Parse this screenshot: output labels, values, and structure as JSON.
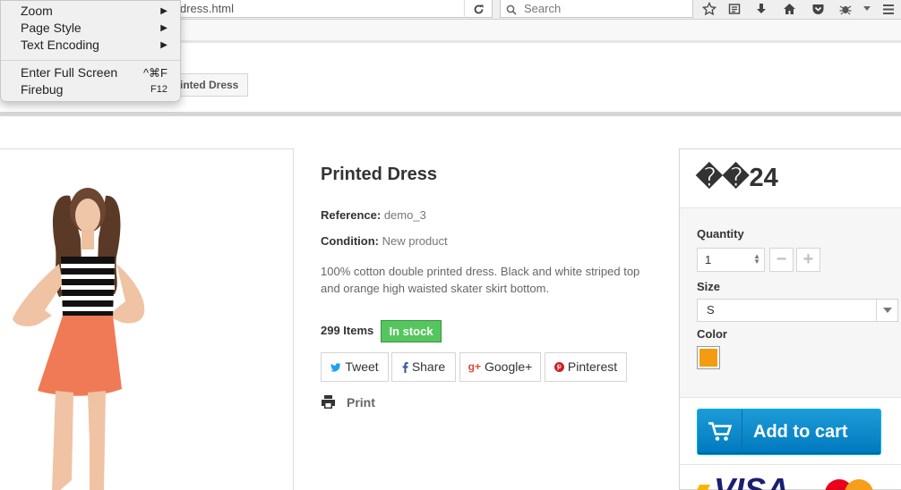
{
  "browser": {
    "url_fragment": "dress.html",
    "search_placeholder": "Search"
  },
  "context_menu": {
    "items": [
      {
        "label": "Zoom"
      },
      {
        "label": "Page Style"
      },
      {
        "label": "Text Encoding"
      },
      {
        "label": "Enter Full Screen",
        "shortcut": "^⌘F"
      },
      {
        "label": "Firebug",
        "shortcut": "F12"
      }
    ]
  },
  "breadcrumb": {
    "current": "Printed Dress",
    "visible_fragment": "inted Dress"
  },
  "product": {
    "title": "Printed Dress",
    "reference_label": "Reference:",
    "reference_value": "demo_3",
    "condition_label": "Condition:",
    "condition_value": "New product",
    "description": "100% cotton double printed dress. Black and white striped top and orange high waisted skater skirt bottom.",
    "items_count": "299 Items",
    "stock_status": "In stock",
    "share": {
      "tweet": "Tweet",
      "share": "Share",
      "google": "Google+",
      "pinterest": "Pinterest"
    },
    "print_label": "Print"
  },
  "buy_box": {
    "price": "��24",
    "quantity_label": "Quantity",
    "quantity_value": "1",
    "size_label": "Size",
    "size_value": "S",
    "color_label": "Color",
    "color_swatch": "#f39c11",
    "add_to_cart": "Add to cart"
  },
  "colors": {
    "stock_green": "#55c65e",
    "cart_blue": "#0079bd"
  }
}
